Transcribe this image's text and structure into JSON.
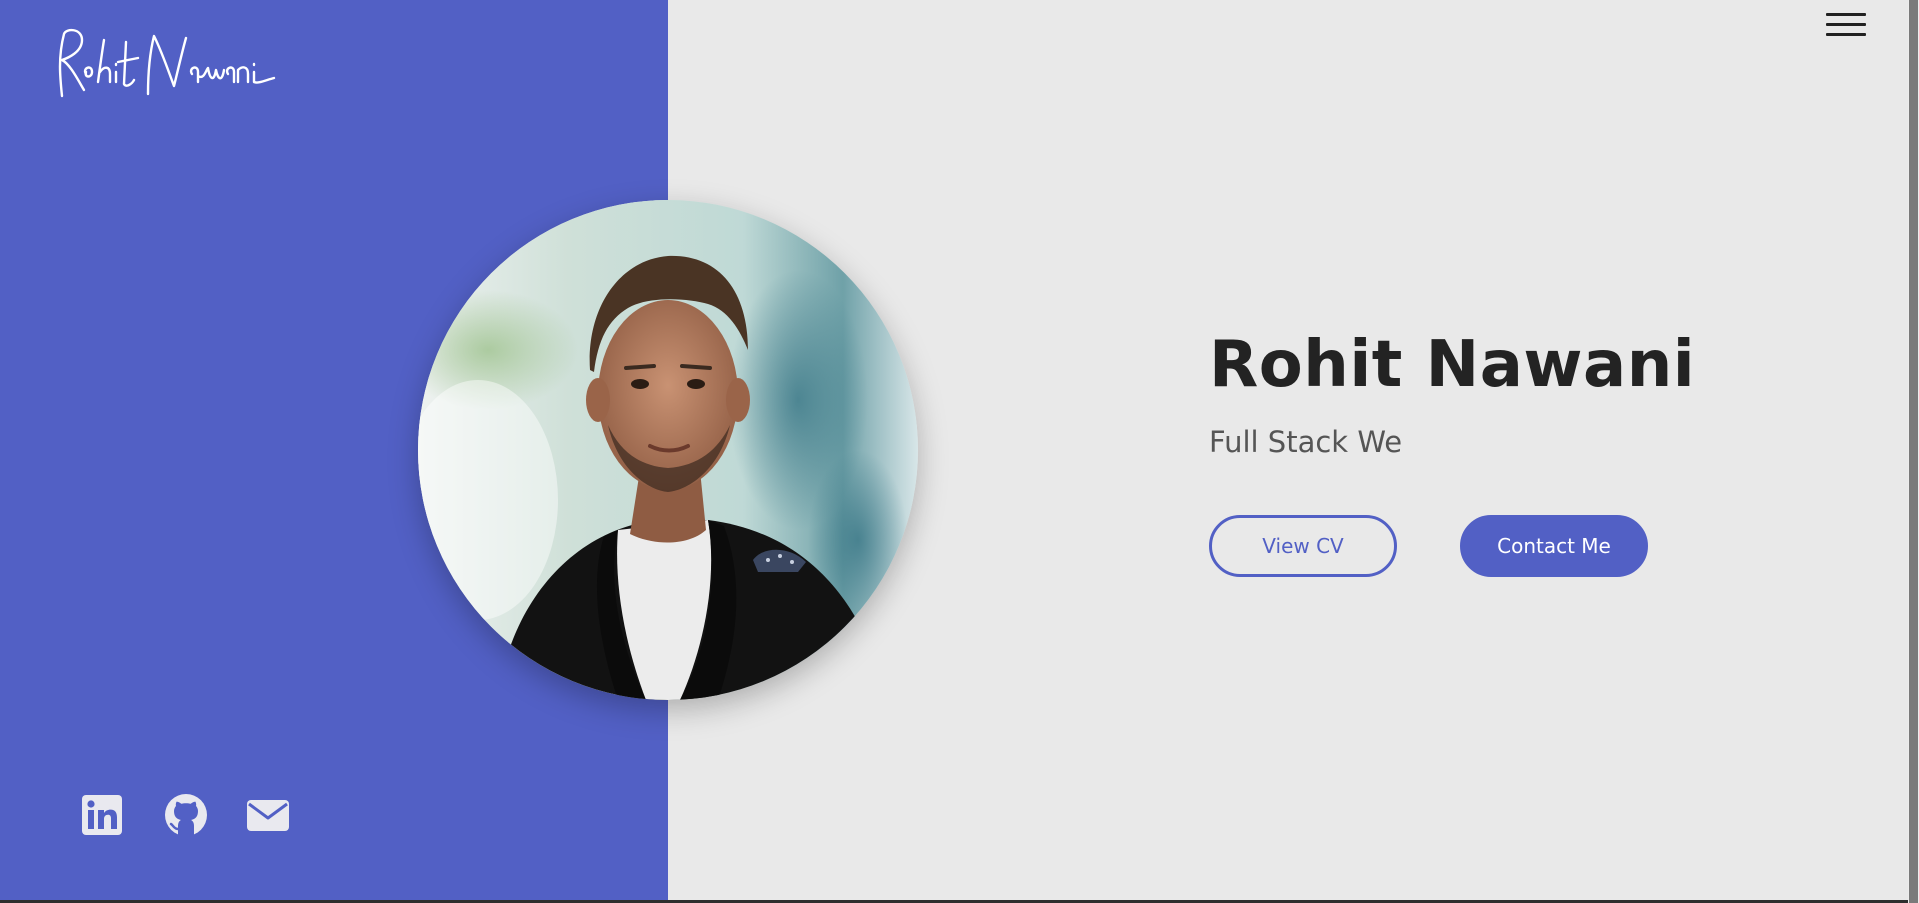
{
  "logo": {
    "text": "Rohit Nawani"
  },
  "header": {
    "menu_icon": "hamburger-menu-icon"
  },
  "hero": {
    "name": "Rohit Nawani",
    "role_typed": "Full Stack We",
    "view_cv_label": "View CV",
    "contact_label": "Contact Me"
  },
  "socials": [
    {
      "icon": "linkedin-icon"
    },
    {
      "icon": "github-icon"
    },
    {
      "icon": "mail-icon"
    }
  ],
  "colors": {
    "accent": "#5260c5",
    "background": "#e9e9e9",
    "heading": "#232323",
    "subheading": "#555555"
  }
}
